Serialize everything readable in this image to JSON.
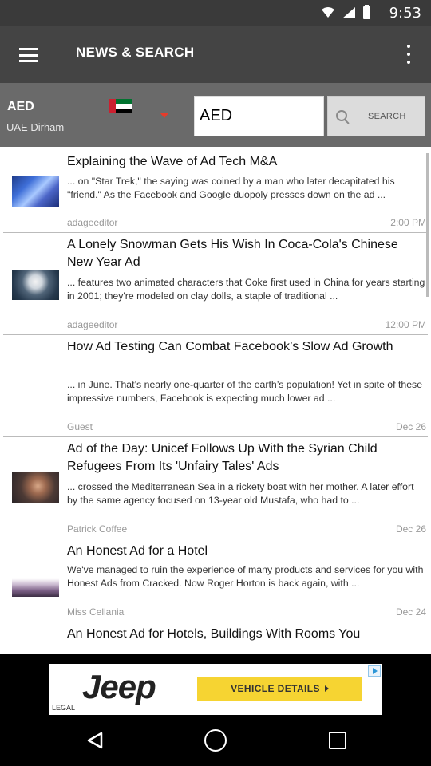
{
  "status_bar": {
    "time": "9:53"
  },
  "app_bar": {
    "title": "NEWS & SEARCH"
  },
  "currency": {
    "code": "AED",
    "name": "UAE Dirham",
    "input_value": "AED",
    "search_label": "SEARCH",
    "flag_colors": {
      "red": "#cc1f2f",
      "green": "#00732f",
      "white": "#ffffff",
      "black": "#000000"
    }
  },
  "news": [
    {
      "headline": "Explaining the Wave of Ad Tech M&A",
      "snippet": "... on \"Star Trek,\" the saying was coined by a man who later decapitated his \"friend.\" As the Facebook and Google duopoly presses down on the ad ...",
      "author": "adageeditor",
      "date": "2:00 PM",
      "has_thumb": true
    },
    {
      "headline": "A Lonely Snowman Gets His Wish In Coca-Cola's Chinese New Year Ad",
      "snippet": "... features two animated characters that Coke first used in China for years starting in 2001; they're modeled on clay dolls, a staple of traditional ...",
      "author": "adageeditor",
      "date": "12:00 PM",
      "has_thumb": true
    },
    {
      "headline": "How Ad Testing Can Combat Facebook’s Slow Ad Growth",
      "snippet": "... in June. That’s nearly one-quarter of the earth’s population! Yet in spite of these impressive numbers, Facebook is expecting much lower ad ...",
      "author": "Guest",
      "date": "Dec 26",
      "has_thumb": false
    },
    {
      "headline": "Ad of the Day: Unicef Follows Up With the Syrian Child Refugees From Its 'Unfairy Tales' Ads",
      "snippet": "... crossed the Mediterranean Sea in a rickety boat with her mother. A later effort by the same agency focused on 13-year old Mustafa, who had to ...",
      "author": "Patrick Coffee",
      "date": "Dec 26",
      "has_thumb": true
    },
    {
      "headline": "An Honest Ad for a Hotel",
      "snippet": "We've managed to ruin the experience of many products and services for you with Honest Ads from Cracked. Now Roger Horton is back again, with ...",
      "author": "Miss Cellania",
      "date": "Dec 24",
      "has_thumb": true
    },
    {
      "headline": "An Honest Ad for Hotels, Buildings With Rooms You",
      "snippet": "",
      "author": "",
      "date": "",
      "has_thumb": false
    }
  ],
  "ad": {
    "brand": "Jeep",
    "legal": "LEGAL",
    "cta": "VEHICLE DETAILS",
    "cta_color": "#f6d432"
  },
  "icons": {
    "menu": "hamburger-menu-icon",
    "overflow": "more-vert-icon",
    "search": "search-icon",
    "dropdown": "dropdown-arrow-icon",
    "nav_back": "back-triangle-icon",
    "nav_home": "home-circle-icon",
    "nav_recent": "recent-apps-square-icon"
  },
  "colors": {
    "status_bar": "#3a3a3a",
    "app_bar": "#444444",
    "currency_row": "#6a6a6a",
    "dropdown_accent": "#e63b2a"
  }
}
